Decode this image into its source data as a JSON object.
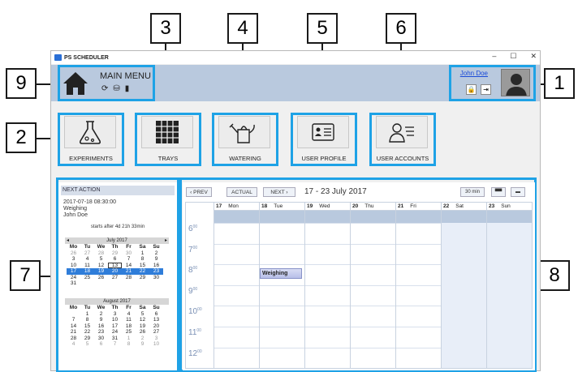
{
  "window": {
    "title": "PS SCHEDULER",
    "minimize": "–",
    "maximize": "☐",
    "close": "✕"
  },
  "callouts": [
    "1",
    "2",
    "3",
    "4",
    "5",
    "6",
    "7",
    "8",
    "9"
  ],
  "main_menu": {
    "label": "MAIN MENU",
    "icons": [
      "refresh-icon",
      "database-icon",
      "phone-icon"
    ]
  },
  "user": {
    "name": "John Doe",
    "buttons": [
      "lock-icon",
      "logout-icon"
    ]
  },
  "tiles": [
    {
      "label": "EXPERIMENTS",
      "icon": "flask-icon"
    },
    {
      "label": "TRAYS",
      "icon": "tray-icon"
    },
    {
      "label": "WATERING",
      "icon": "watering-can-icon"
    },
    {
      "label": "USER PROFILE",
      "icon": "id-card-icon"
    },
    {
      "label": "USER ACCOUNTS",
      "icon": "user-list-icon"
    }
  ],
  "next_action": {
    "header": "NEXT ACTION",
    "datetime": "2017-07-18 08:30:00",
    "action": "Weighing",
    "user": "John Doe",
    "starts": "starts after 4d 21h 33min"
  },
  "mini_calendars": [
    {
      "title": "July 2017",
      "day_names": [
        "Mo",
        "Tu",
        "We",
        "Th",
        "Fr",
        "Sa",
        "Su"
      ],
      "weeks": [
        [
          "26",
          "27",
          "28",
          "29",
          "30",
          "1",
          "2"
        ],
        [
          "3",
          "4",
          "5",
          "6",
          "7",
          "8",
          "9"
        ],
        [
          "10",
          "11",
          "12",
          "13",
          "14",
          "15",
          "16"
        ],
        [
          "17",
          "18",
          "19",
          "20",
          "21",
          "22",
          "23"
        ],
        [
          "24",
          "25",
          "26",
          "27",
          "28",
          "29",
          "30"
        ],
        [
          "31",
          "",
          "",
          "",
          "",
          "",
          ""
        ]
      ]
    },
    {
      "title": "August 2017",
      "day_names": [
        "Mo",
        "Tu",
        "We",
        "Th",
        "Fr",
        "Sa",
        "Su"
      ],
      "weeks": [
        [
          "",
          "1",
          "2",
          "3",
          "4",
          "5",
          "6"
        ],
        [
          "7",
          "8",
          "9",
          "10",
          "11",
          "12",
          "13"
        ],
        [
          "14",
          "15",
          "16",
          "17",
          "18",
          "19",
          "20"
        ],
        [
          "21",
          "22",
          "23",
          "24",
          "25",
          "26",
          "27"
        ],
        [
          "28",
          "29",
          "30",
          "31",
          "1",
          "2",
          "3"
        ],
        [
          "4",
          "5",
          "6",
          "7",
          "8",
          "9",
          "10"
        ]
      ]
    }
  ],
  "scheduler": {
    "prev": "‹  PREV",
    "actual": "ACTUAL",
    "next": "NEXT  ›",
    "range": "17 - 23  July 2017",
    "interval": "30 min",
    "days": [
      {
        "num": "17",
        "name": "Mon"
      },
      {
        "num": "18",
        "name": "Tue"
      },
      {
        "num": "19",
        "name": "Wed"
      },
      {
        "num": "20",
        "name": "Thu"
      },
      {
        "num": "21",
        "name": "Fri"
      },
      {
        "num": "22",
        "name": "Sat"
      },
      {
        "num": "23",
        "name": "Sun"
      }
    ],
    "hours": [
      "6",
      "7",
      "8",
      "9",
      "10",
      "11",
      "12"
    ],
    "minutes": "00",
    "event": {
      "label": "Weighing",
      "day": "Tue"
    }
  },
  "colors": {
    "accent": "#1ea2e6",
    "menubar": "#b9c9de",
    "selected": "#2f7dd9"
  }
}
